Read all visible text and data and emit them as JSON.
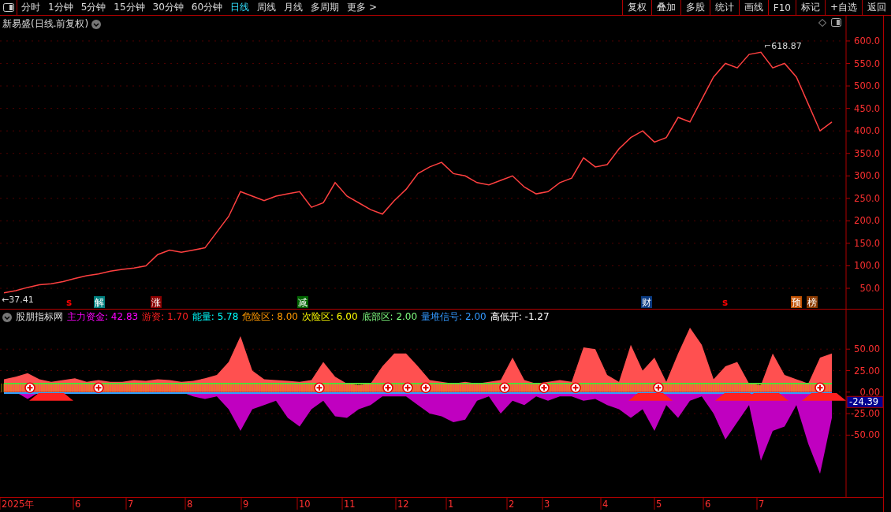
{
  "toolbar": {
    "periods": [
      {
        "label": "分时",
        "selected": false
      },
      {
        "label": "1分钟",
        "selected": false
      },
      {
        "label": "5分钟",
        "selected": false
      },
      {
        "label": "15分钟",
        "selected": false
      },
      {
        "label": "30分钟",
        "selected": false
      },
      {
        "label": "60分钟",
        "selected": false
      },
      {
        "label": "日线",
        "selected": true
      },
      {
        "label": "周线",
        "selected": false
      },
      {
        "label": "月线",
        "selected": false
      },
      {
        "label": "多周期",
        "selected": false
      },
      {
        "label": "更多 >",
        "selected": false
      }
    ],
    "buttons": [
      "复权",
      "叠加",
      "多股",
      "统计",
      "画线",
      "F10",
      "标记",
      "+自选",
      "返回"
    ]
  },
  "price_pane": {
    "title": "新易盛(日线.前复权)",
    "high_label": "⌐618.87",
    "low_label": "←37.41",
    "signals": [
      {
        "text": "s",
        "kind": "plain",
        "color": "#ff0000"
      },
      {
        "text": "解",
        "kind": "boxed",
        "color": "#00807f"
      },
      {
        "text": "涨",
        "kind": "boxed",
        "color": "#8b0000"
      },
      {
        "text": "减",
        "kind": "boxed",
        "color": "#006400"
      },
      {
        "text": "财",
        "kind": "boxed",
        "color": "#0a3a80"
      },
      {
        "text": "s",
        "kind": "plain",
        "color": "#ff0000"
      },
      {
        "text": "预",
        "kind": "boxed",
        "color": "#c05000"
      },
      {
        "text": "榜",
        "kind": "boxed",
        "color": "#8b3a00"
      }
    ],
    "chart_data": {
      "type": "line",
      "grid": true,
      "ylim": [
        4.5,
        656
      ],
      "yticks": [
        {
          "value": 50,
          "label": "50.0"
        },
        {
          "value": 100,
          "label": "100.0"
        },
        {
          "value": 150,
          "label": "150.0"
        },
        {
          "value": 200,
          "label": "200.0"
        },
        {
          "value": 250,
          "label": "250.0"
        },
        {
          "value": 300,
          "label": "300.0"
        },
        {
          "value": 350,
          "label": "350.0"
        },
        {
          "value": 400,
          "label": "400.0"
        },
        {
          "value": 450,
          "label": "450.0"
        },
        {
          "value": 500,
          "label": "500.0"
        },
        {
          "value": 550,
          "label": "550.0"
        },
        {
          "value": 600,
          "label": "600.0"
        }
      ],
      "series": [
        {
          "color": "#ff4040",
          "values": [
            40,
            45,
            52,
            58,
            60,
            65,
            72,
            78,
            82,
            88,
            92,
            95,
            100,
            125,
            135,
            130,
            135,
            140,
            175,
            210,
            265,
            255,
            245,
            255,
            260,
            265,
            230,
            240,
            285,
            255,
            240,
            225,
            215,
            245,
            270,
            305,
            320,
            330,
            305,
            300,
            285,
            280,
            290,
            300,
            275,
            260,
            265,
            285,
            295,
            340,
            320,
            325,
            360,
            385,
            400,
            375,
            385,
            430,
            420,
            470,
            520,
            550,
            540,
            570,
            575,
            540,
            550,
            520,
            460,
            400,
            420
          ]
        }
      ]
    }
  },
  "indicator_pane": {
    "name": "股朋指标网",
    "legend": [
      {
        "text": "主力资金: 42.83",
        "color": "#ff00ff"
      },
      {
        "text": "游资: 1.70",
        "color": "#ff2020"
      },
      {
        "text": "能量: 5.78",
        "color": "#00ffff"
      },
      {
        "text": "危险区: 8.00",
        "color": "#ff9900"
      },
      {
        "text": "次险区: 6.00",
        "color": "#ffff00"
      },
      {
        "text": "底部区: 2.00",
        "color": "#80ff80"
      },
      {
        "text": "量堆信号: 2.00",
        "color": "#3399ff"
      },
      {
        "text": "高低开: -1.27",
        "color": "#ffffff"
      }
    ],
    "readout": "-24.39",
    "chart_data": {
      "type": "area",
      "grid": true,
      "ylim": [
        -122,
        96
      ],
      "yticks": [
        {
          "value": 50,
          "label": "50.00"
        },
        {
          "value": 25,
          "label": "25.00"
        },
        {
          "value": 0,
          "label": "0.00"
        },
        {
          "value": -25,
          "label": "-25.00"
        },
        {
          "value": -50,
          "label": "-50.00"
        }
      ],
      "series": [
        {
          "color": "#ff5050",
          "values": [
            15,
            18,
            22,
            15,
            12,
            14,
            16,
            12,
            14,
            12,
            12,
            14,
            13,
            15,
            14,
            12,
            13,
            16,
            20,
            35,
            65,
            25,
            15,
            14,
            13,
            12,
            14,
            35,
            18,
            10,
            8,
            10,
            30,
            45,
            45,
            30,
            14,
            12,
            10,
            12,
            10,
            12,
            14,
            40,
            14,
            10,
            12,
            14,
            12,
            52,
            50,
            20,
            12,
            55,
            25,
            40,
            12,
            45,
            75,
            55,
            15,
            30,
            35,
            10,
            8,
            45,
            20,
            15,
            10,
            40,
            45
          ]
        },
        {
          "color": "#c000c0",
          "values": [
            0,
            0,
            -8,
            null,
            0,
            0,
            0,
            0,
            0,
            0,
            0,
            0,
            0,
            0,
            0,
            0,
            -5,
            -8,
            -5,
            -20,
            -45,
            -20,
            -15,
            -10,
            -30,
            -40,
            -20,
            -10,
            -28,
            -30,
            -20,
            -15,
            -5,
            -5,
            -5,
            -15,
            -25,
            -28,
            -35,
            -32,
            -10,
            -5,
            -25,
            -10,
            -15,
            -5,
            -10,
            -5,
            -5,
            -10,
            -8,
            -15,
            -20,
            -30,
            -20,
            -45,
            -15,
            -30,
            -10,
            -5,
            -25,
            -55,
            -35,
            -15,
            -80,
            -45,
            -40,
            -15,
            -60,
            -95,
            -30
          ]
        },
        {
          "type": "line",
          "color": "#40e040",
          "values": [
            10,
            10,
            10,
            10,
            10,
            10,
            10,
            10,
            10,
            10,
            10,
            10,
            10,
            10,
            10,
            10,
            10,
            10,
            10,
            10,
            10,
            10,
            10,
            10,
            10,
            10,
            10,
            10,
            10,
            10,
            10,
            10,
            10,
            10,
            10,
            10,
            10,
            10,
            10,
            10,
            10,
            10,
            10,
            10,
            10,
            10,
            10,
            10,
            10,
            10,
            10,
            10,
            10,
            10,
            10,
            10,
            10,
            10,
            10,
            10,
            10,
            10,
            10,
            10,
            10,
            10,
            10,
            10,
            10,
            10,
            10
          ]
        },
        {
          "type": "line",
          "color": "#30a0ff",
          "values": [
            -1,
            -1,
            -1,
            -1,
            -1,
            -1,
            -1,
            -1,
            -1,
            -1,
            -1,
            -1,
            -1,
            -1,
            -1,
            -1,
            -1,
            -1,
            -1,
            -1,
            -1,
            -1,
            -1,
            -1,
            -1,
            -1,
            -1,
            -1,
            -1,
            -1,
            -1,
            -1,
            -1,
            -1,
            -1,
            -1,
            -1,
            -1,
            -1,
            -1,
            -1,
            -1,
            -1,
            -1,
            -1,
            -1,
            -1,
            -1,
            -1,
            -1,
            -1,
            -1,
            -1,
            -1,
            -1,
            -1,
            -1,
            -1,
            -1,
            -1,
            -1,
            -1,
            -1,
            -1,
            -1,
            -1,
            -1,
            -1,
            -1,
            -1,
            -1
          ]
        }
      ]
    }
  },
  "date_axis": [
    "2025年",
    "6",
    "7",
    "8",
    "9",
    "10",
    "11",
    "12",
    "1",
    "2",
    "3",
    "4",
    "5",
    "6",
    "7"
  ]
}
